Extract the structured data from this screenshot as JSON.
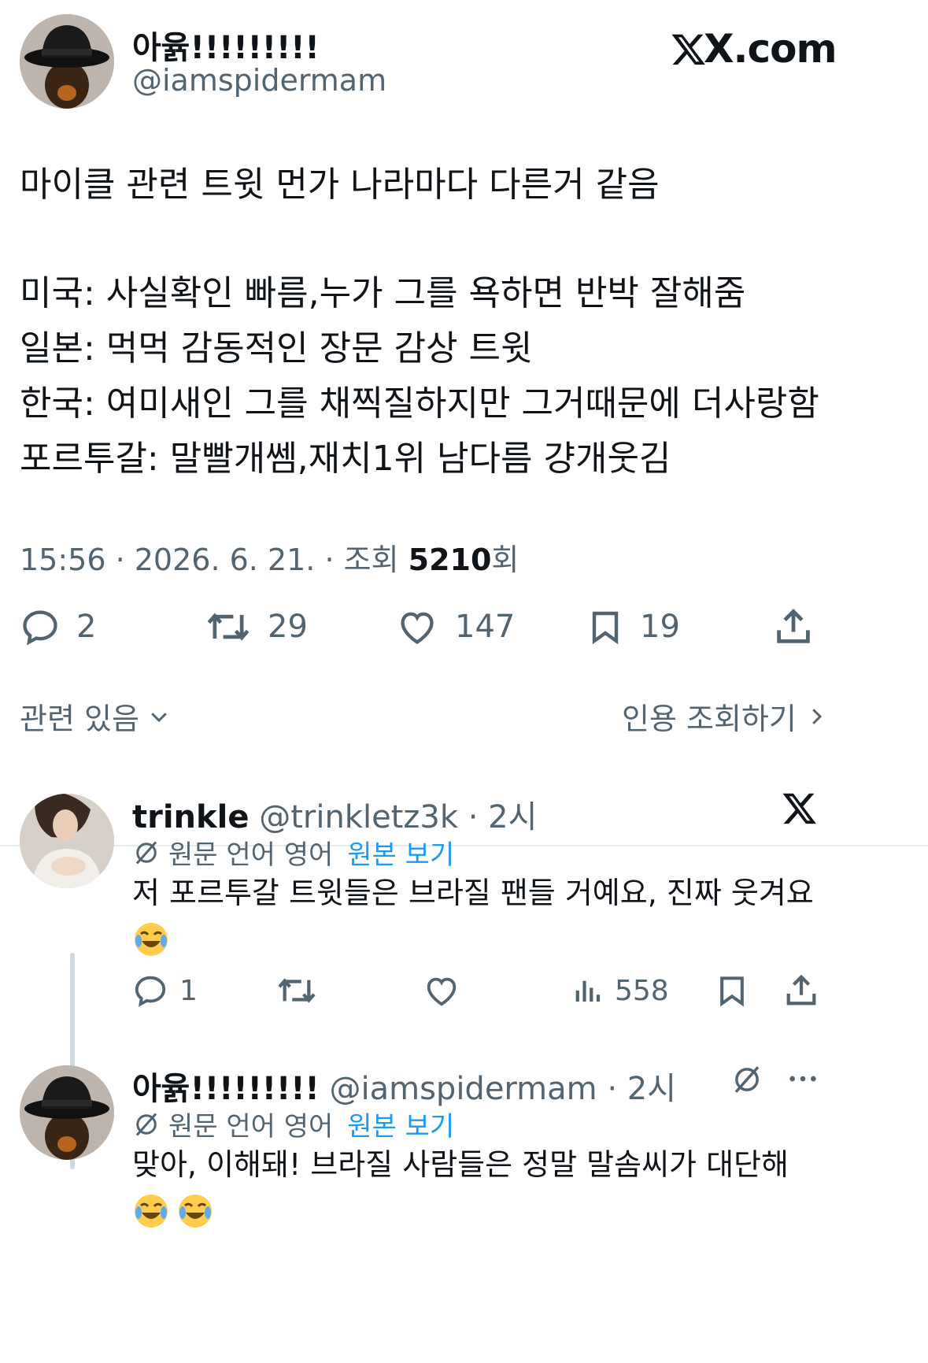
{
  "brand": {
    "logo_text": "X.com"
  },
  "author": {
    "display_name": "아윩!!!!!!!!!",
    "handle": "@iamspidermam"
  },
  "tweet": {
    "lines": [
      "마이클 관련 트윗 먼가 나라마다 다른거 같음",
      "",
      "미국: 사실확인 빠름,누가 그를 욕하면 반박 잘해줌",
      "일본: 먹먹 감동적인 장문 감상 트윗",
      "한국: 여미새인 그를 채찍질하지만 그거때문에 더사랑함",
      "포르투갈: 말빨개쎔,재치1위 남다름 걍개웃김"
    ],
    "meta_prefix": "15:56 · 2026. 6. 21. · 조회 ",
    "views": "5210",
    "views_suffix": "회"
  },
  "stats": {
    "replies": "2",
    "retweets": "29",
    "likes": "147",
    "bookmarks": "19"
  },
  "links": {
    "related": "관련 있음",
    "quotes": "인용 조회하기"
  },
  "replies": [
    {
      "display_name": "trinkle",
      "handle": "@trinkletz3k",
      "time": "· 2시",
      "translate_note": "원문 언어 영어",
      "translate_link": "원본 보기",
      "text": "저 포르투갈 트윗들은 브라질 팬들 거예요, 진짜 웃겨요",
      "stats": {
        "replies": "1",
        "views": "558"
      }
    },
    {
      "display_name": "아윩!!!!!!!!!",
      "handle": "@iamspidermam",
      "time": "· 2시",
      "translate_note": "원문 언어 영어",
      "translate_link": "원본 보기",
      "text": "맞아, 이해돼! 브라질 사람들은 정말 말솜씨가 대단해"
    }
  ],
  "icons": {
    "reply": "reply-icon",
    "retweet": "retweet-icon",
    "like": "heart-icon",
    "bookmark": "bookmark-icon",
    "share": "share-icon",
    "views": "views-icon",
    "translate": "translate-icon",
    "more": "more-icon",
    "emoji": "laughing-emoji-icon"
  },
  "colors": {
    "text": "#0f1419",
    "secondary": "#536471",
    "accent": "#1d9bf0",
    "divider": "#e6ecf0"
  }
}
